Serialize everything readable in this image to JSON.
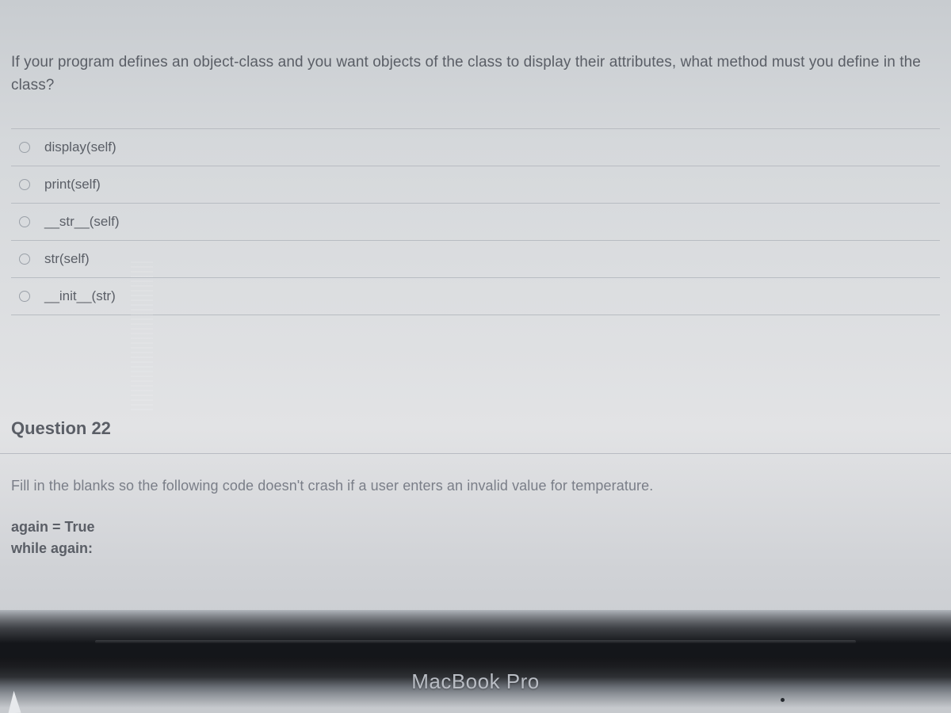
{
  "question21": {
    "prompt": "If your program defines an object-class and you want objects of the class to display their attributes, what method must you define in the class?",
    "options": [
      "display(self)",
      "print(self)",
      "__str__(self)",
      "str(self)",
      "__init__(str)"
    ]
  },
  "question22": {
    "heading": "Question 22",
    "prompt": "Fill in the blanks so the following code doesn't crash if a user enters an invalid value for temperature.",
    "code_lines": [
      "again = True",
      "while again:"
    ]
  },
  "device": {
    "brand": "MacBook Pro"
  }
}
